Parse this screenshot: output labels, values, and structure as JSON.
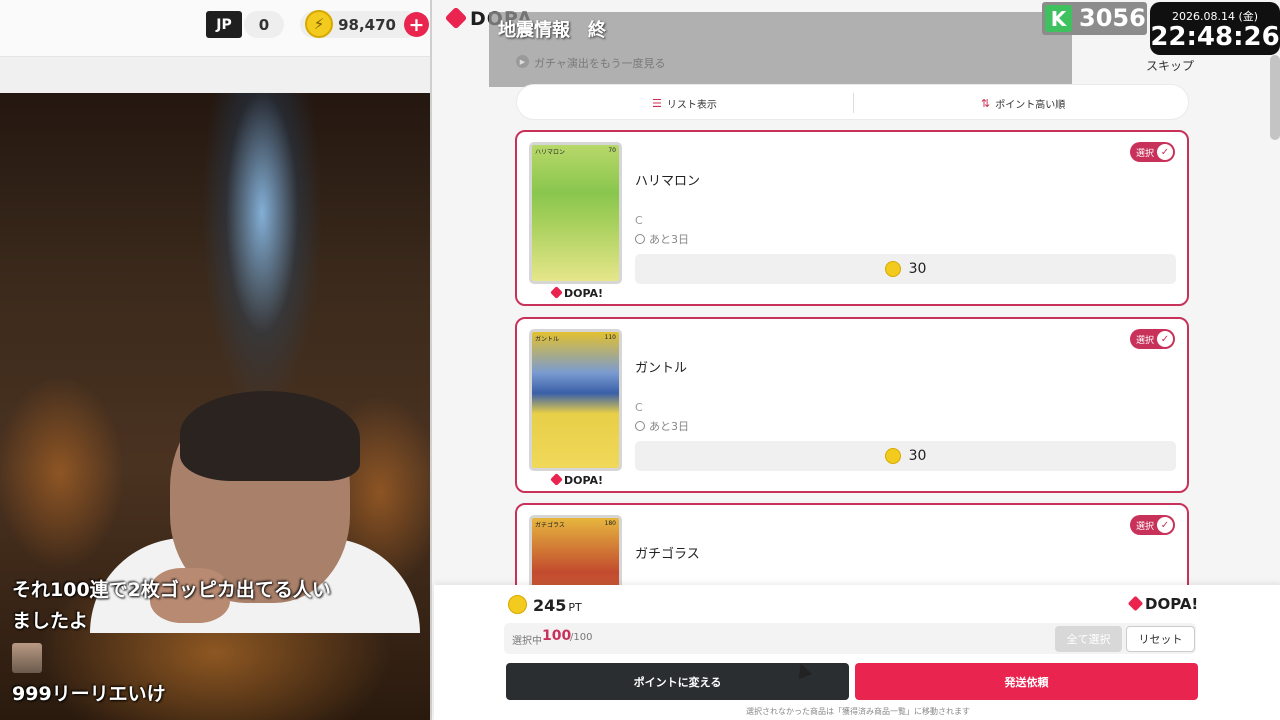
{
  "stream": {
    "jp_label": "JP",
    "jp_count": "0",
    "coin_balance": "98,470",
    "plus": "+",
    "chat_message": "それ100連で2枚ゴッピカ出てる人いましたよ",
    "chat_user": "999リーリエいけ"
  },
  "header": {
    "logo": "DOPA",
    "skip": "スキップ",
    "k_label": "K",
    "k_value": "3056",
    "clock_date": "2026.08.14 (金)",
    "clock_time": "22:48:26"
  },
  "notice": {
    "title": "地震情報　終",
    "replay": "ガチャ演出をもう一度見る"
  },
  "view": {
    "list_label": "リスト表示",
    "sort_label": "ポイント高い順"
  },
  "cards": [
    {
      "name": "ハリマロン",
      "rarity": "C",
      "time": "あと3日",
      "points": "30",
      "select": "選択",
      "card_title": "ハリマロン",
      "hp": "70"
    },
    {
      "name": "ガントル",
      "rarity": "C",
      "time": "あと3日",
      "points": "30",
      "select": "選択",
      "card_title": "ガントル",
      "hp": "110"
    },
    {
      "name": "ガチゴラス",
      "rarity": "",
      "time": "",
      "points": "",
      "select": "選択",
      "card_title": "ガチゴラス",
      "hp": "180"
    }
  ],
  "brand_mark": "DOPA!",
  "bottom": {
    "points": "245",
    "points_unit": "PT",
    "logo": "DOPA!",
    "selected_label": "選択中",
    "selected_count": "100",
    "selected_total": "/100",
    "select_all": "全て選択",
    "reset": "リセット",
    "convert": "ポイントに変える",
    "ship": "発送依頼",
    "footer": "選択されなかった商品は「獲得済み商品一覧」に移動されます"
  },
  "colors": {
    "accent": "#e8244f",
    "card_border": "#c8325a"
  }
}
